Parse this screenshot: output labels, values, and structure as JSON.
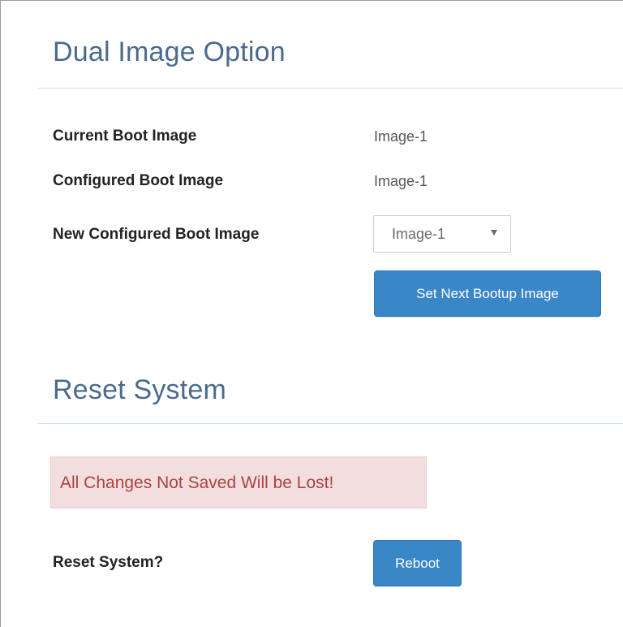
{
  "dual_image": {
    "title": "Dual Image Option",
    "current_boot_label": "Current Boot Image",
    "current_boot_value": "Image-1",
    "configured_boot_label": "Configured Boot Image",
    "configured_boot_value": "Image-1",
    "new_configured_label": "New Configured Boot Image",
    "new_configured_selected": "Image-1",
    "set_button_label": "Set Next Bootup Image"
  },
  "reset": {
    "title": "Reset System",
    "warning_text": "All Changes Not Saved Will be Lost!",
    "question_label": "Reset System?",
    "reboot_button_label": "Reboot"
  },
  "icons": {
    "select_arrow": "chevron-down-icon"
  },
  "colors": {
    "title": "#4b6b8c",
    "button": "#3a87c8",
    "alert_bg": "#f2dede",
    "alert_text": "#a94442",
    "divider": "#c6dff0"
  }
}
